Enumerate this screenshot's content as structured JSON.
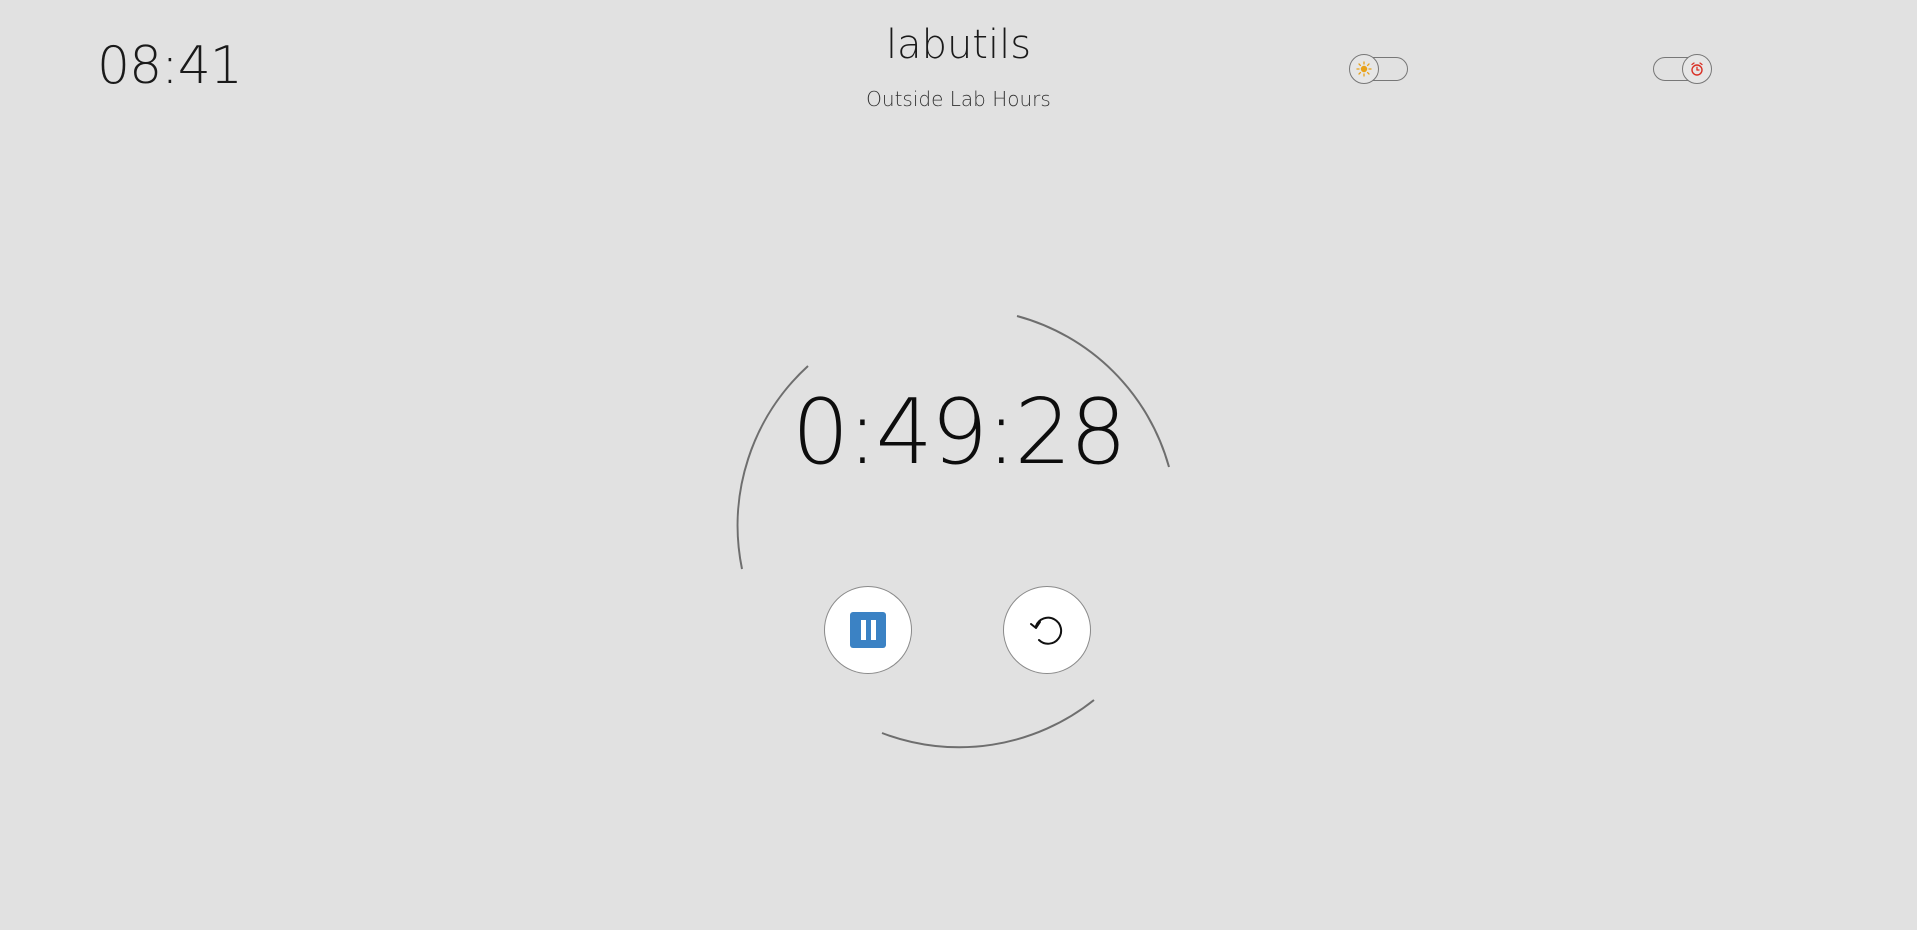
{
  "header": {
    "clock": "08:41",
    "app_title": "labutils",
    "subtitle": "Outside Lab Hours"
  },
  "toggles": {
    "theme": {
      "icon": "sun-icon",
      "icon_color": "#e8a21a",
      "state": "off"
    },
    "alarm": {
      "icon": "alarm-clock-icon",
      "icon_color": "#d93025",
      "state": "on"
    }
  },
  "timer": {
    "remaining": "0:49:28",
    "state": "running",
    "ring_color": "#6e6e6e"
  },
  "controls": {
    "pause": {
      "icon": "pause-icon",
      "color": "#3b82c4"
    },
    "reset": {
      "icon": "reset-icon"
    }
  }
}
